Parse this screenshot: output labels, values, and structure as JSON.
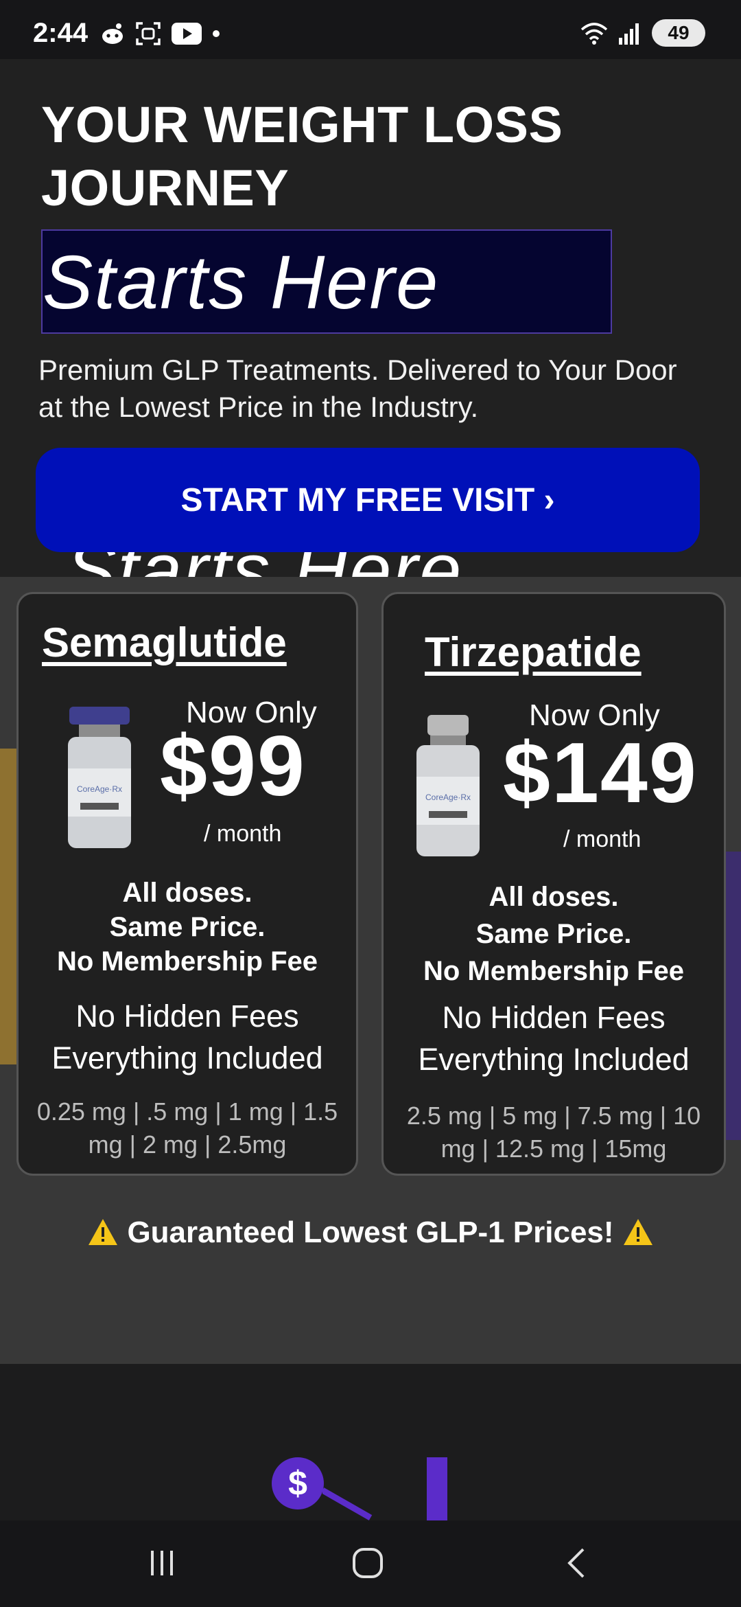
{
  "status_bar": {
    "time": "2:44",
    "battery": "49",
    "left_icons": [
      "reddit-icon",
      "screenshot-icon",
      "youtube-icon",
      "dot-icon"
    ],
    "right_icons": [
      "wifi-icon",
      "signal-icon",
      "battery-icon"
    ]
  },
  "hero": {
    "title": "YOUR WEIGHT LOSS JOURNEY",
    "highlight": "Starts Here",
    "subtitle": "Premium GLP Treatments. Delivered to Your Door at the Lowest Price in the Industry.",
    "cta_label": "START MY FREE VISIT ›",
    "ghost_text": "Starts Here"
  },
  "cards": [
    {
      "title": "Semaglutide",
      "now_only": "Now Only",
      "price": "$99",
      "per": "/ month",
      "bold_lines": [
        "All doses.",
        "Same Price.",
        "No Membership Fee"
      ],
      "plain_lines": [
        "No Hidden Fees",
        "Everything Included"
      ],
      "doses": "0.25 mg | .5 mg | 1 mg | 1.5 mg | 2 mg | 2.5mg",
      "vial_label": "CoreAge·Rx"
    },
    {
      "title": "Tirzepatide",
      "now_only": "Now Only",
      "price": "$149",
      "per": "/ month",
      "bold_lines": [
        "All doses.",
        "Same Price.",
        "No Membership Fee"
      ],
      "plain_lines": [
        "No Hidden Fees",
        "Everything Included"
      ],
      "doses": "2.5 mg | 5 mg | 7.5 mg | 10 mg | 12.5 mg | 15mg",
      "vial_label": "CoreAge·Rx"
    }
  ],
  "guarantee": "Guaranteed Lowest GLP-1 Prices!",
  "lower": {
    "dollar_symbol": "$"
  },
  "nav": {
    "buttons": [
      "recent-apps",
      "home",
      "back"
    ]
  },
  "colors": {
    "cta_blue": "#0010b8",
    "highlight_bg": "#050530",
    "accent_purple": "#5b2cc9",
    "warning_yellow": "#f5c518"
  }
}
